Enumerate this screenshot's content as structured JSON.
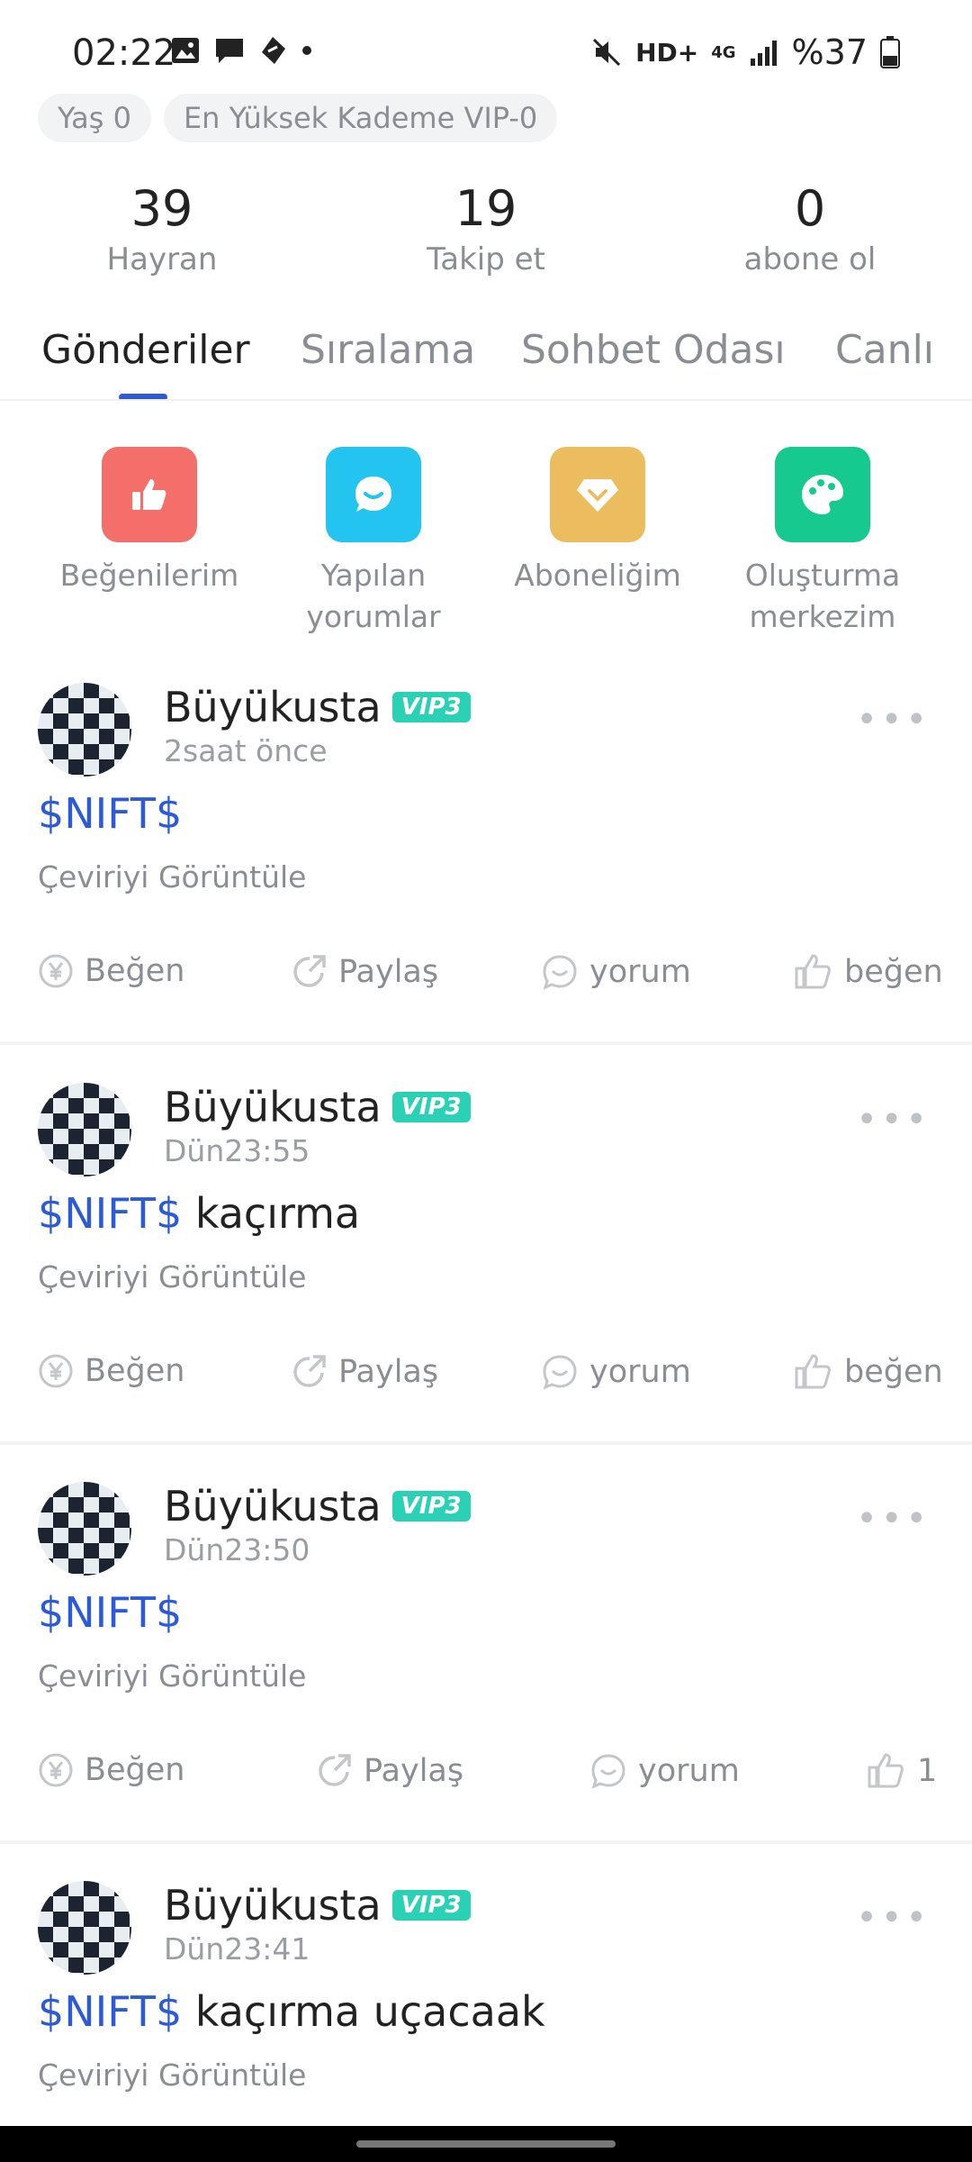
{
  "status_bar": {
    "time": "02:22",
    "network": "HD+",
    "signal_type": "4G",
    "battery": "%37"
  },
  "tags": [
    "Yaş 0",
    "En Yüksek Kademe VIP-0"
  ],
  "stats": [
    {
      "value": "39",
      "label": "Hayran"
    },
    {
      "value": "19",
      "label": "Takip et"
    },
    {
      "value": "0",
      "label": "abone ol"
    }
  ],
  "tabs": [
    "Gönderiler",
    "Sıralama",
    "Sohbet Odası",
    "Canlı"
  ],
  "shortcuts": [
    {
      "label": "Beğenilerim",
      "icon": "thumbs-up-icon",
      "color": "#f46f6a"
    },
    {
      "label": "Yapılan yorumlar",
      "icon": "chat-bubble-icon",
      "color": "#23c4f0"
    },
    {
      "label": "Aboneliğim",
      "icon": "diamond-icon",
      "color": "#ebbd5e"
    },
    {
      "label": "Oluşturma merkezim",
      "icon": "palette-icon",
      "color": "#16c98f"
    }
  ],
  "posts": [
    {
      "username": "Büyükusta",
      "vip": "VIP3",
      "time": "2saat önce",
      "ticker": "$NIFT$",
      "text": "",
      "translate": "Çeviriyi Görüntüle",
      "actions": {
        "tip": "Beğen",
        "share": "Paylaş",
        "comment": "yorum",
        "like": "beğen"
      }
    },
    {
      "username": "Büyükusta",
      "vip": "VIP3",
      "time": "Dün23:55",
      "ticker": "$NIFT$",
      "text": " kaçırma",
      "translate": "Çeviriyi Görüntüle",
      "actions": {
        "tip": "Beğen",
        "share": "Paylaş",
        "comment": "yorum",
        "like": "beğen"
      }
    },
    {
      "username": "Büyükusta",
      "vip": "VIP3",
      "time": "Dün23:50",
      "ticker": "$NIFT$",
      "text": "",
      "translate": "Çeviriyi Görüntüle",
      "actions": {
        "tip": "Beğen",
        "share": "Paylaş",
        "comment": "yorum",
        "like": "1"
      }
    },
    {
      "username": "Büyükusta",
      "vip": "VIP3",
      "time": "Dün23:41",
      "ticker": "$NIFT$",
      "text": " kaçırma uçacaak",
      "translate": "Çeviriyi Görüntüle",
      "actions": null
    }
  ],
  "colors": {
    "accent": "#2d5bd7",
    "vip": "#2bd1b5",
    "muted": "#8a8d93"
  }
}
